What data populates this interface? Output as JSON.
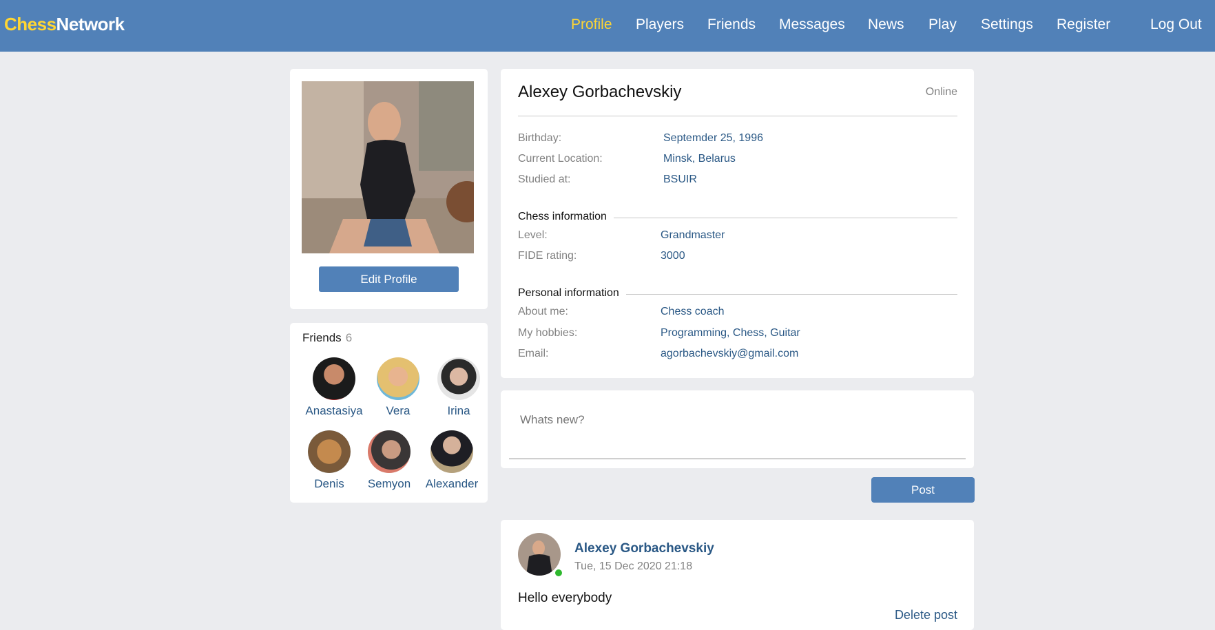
{
  "header": {
    "logo_part1": "Chess",
    "logo_part2": "Network",
    "brand_color": "#5181b8",
    "active_color": "#ffd633",
    "nav": [
      "Profile",
      "Players",
      "Friends",
      "Messages",
      "News",
      "Play",
      "Settings",
      "Register",
      "Log Out"
    ],
    "active_nav": "Profile"
  },
  "sidebar": {
    "edit_label": "Edit Profile",
    "friends_title": "Friends",
    "friends_count": "6",
    "friends": [
      "Anastasiya",
      "Vera",
      "Irina",
      "Denis",
      "Semyon",
      "Alexander"
    ]
  },
  "profile": {
    "name": "Alexey Gorbachevskiy",
    "status": "Online",
    "basic": [
      {
        "label": "Birthday:",
        "value": "Septemder 25, 1996"
      },
      {
        "label": "Current Location:",
        "value": "Minsk, Belarus"
      },
      {
        "label": "Studied at:",
        "value": "BSUIR"
      }
    ],
    "chess_title": "Chess information",
    "chess": [
      {
        "label": "Level:",
        "value": "Grandmaster"
      },
      {
        "label": "FIDE rating:",
        "value": "3000"
      }
    ],
    "personal_title": "Personal information",
    "personal": [
      {
        "label": "About me:",
        "value": "Chess coach"
      },
      {
        "label": "My hobbies:",
        "value": "Programming, Chess, Guitar"
      },
      {
        "label": "Email:",
        "value": "agorbachevskiy@gmail.com"
      }
    ]
  },
  "composer": {
    "placeholder": "Whats new?",
    "post_label": "Post"
  },
  "post": {
    "author": "Alexey Gorbachevskiy",
    "date": "Tue, 15 Dec 2020 21:18",
    "text": "Hello everybody",
    "delete_label": "Delete post"
  }
}
